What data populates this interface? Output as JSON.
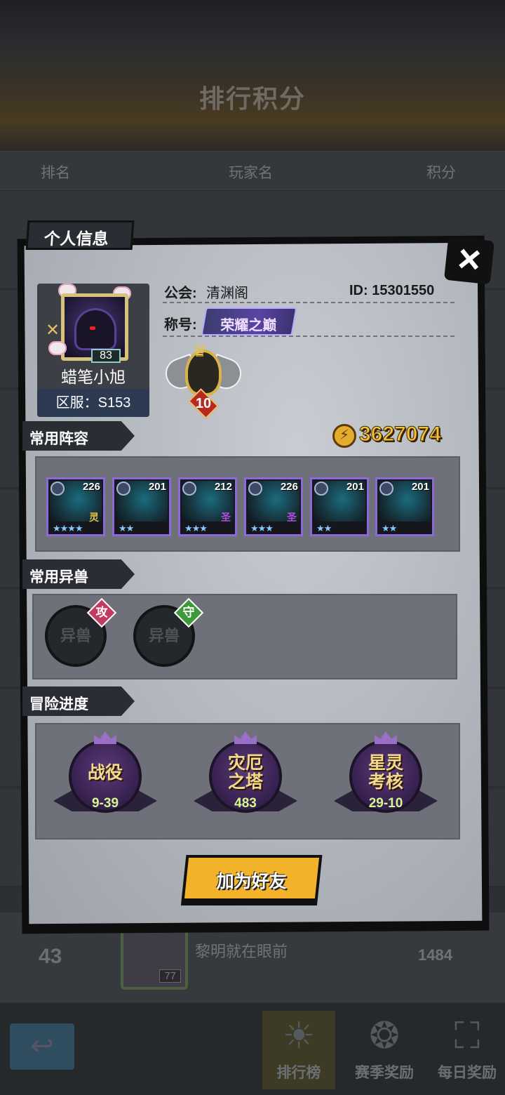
{
  "background": {
    "title": "排行积分",
    "columns": [
      "排名",
      "玩家名",
      "积分"
    ],
    "my_row": {
      "rank": "43",
      "avatar_level": "77",
      "player_name": "黎明就在眼前",
      "score": "1484"
    },
    "nav": {
      "ranking": "排行榜",
      "season_reward": "赛季奖励",
      "daily_reward": "每日奖励"
    }
  },
  "modal": {
    "title": "个人信息",
    "close_icon": "×",
    "avatar": {
      "level": "83",
      "name": "蜡笔小旭",
      "server": "区服：S153"
    },
    "guild_label": "公会:",
    "guild_value": "清渊阁",
    "id_text": "ID: 15301550",
    "title_label": "称号:",
    "title_badge": "荣耀之巅",
    "rank_level": "10",
    "lineup_header": "常用阵容",
    "power": "3627074",
    "heroes": [
      {
        "level": "226",
        "stars": "★★★★",
        "tag": "灵",
        "tag_color": "#e4c243"
      },
      {
        "level": "201",
        "stars": "★★",
        "tag": "",
        "tag_color": ""
      },
      {
        "level": "212",
        "stars": "★★★",
        "tag": "圣",
        "tag_color": "#b14de0"
      },
      {
        "level": "226",
        "stars": "★★★",
        "tag": "圣",
        "tag_color": "#b14de0"
      },
      {
        "level": "201",
        "stars": "★★",
        "tag": "",
        "tag_color": ""
      },
      {
        "level": "201",
        "stars": "★★",
        "tag": "",
        "tag_color": ""
      }
    ],
    "beast_header": "常用异兽",
    "beasts": [
      {
        "label": "异兽",
        "tag": "攻",
        "tag_color": "#c03a63"
      },
      {
        "label": "异兽",
        "tag": "守",
        "tag_color": "#3d9a3a"
      }
    ],
    "adventure_header": "冒险进度",
    "adventures": [
      {
        "name": "战役",
        "value": "9-39"
      },
      {
        "name": "灾厄\n之塔",
        "value": "483"
      },
      {
        "name": "星灵\n考核",
        "value": "29-10"
      }
    ],
    "add_friend": "加为好友"
  }
}
